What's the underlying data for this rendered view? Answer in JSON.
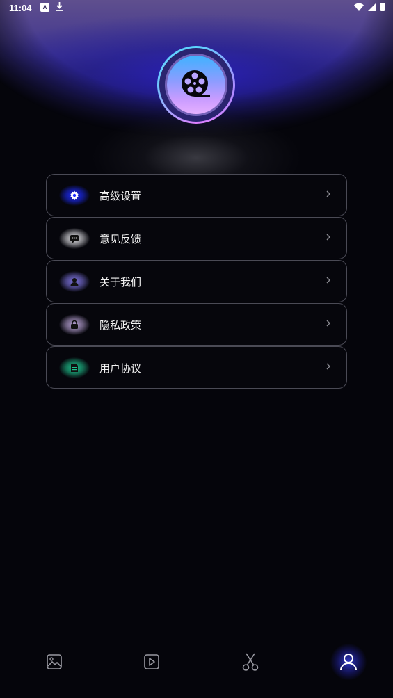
{
  "status_bar": {
    "time": "11:04",
    "a_icon": "A"
  },
  "logo": {
    "icon": "film-reel-icon"
  },
  "menu": {
    "items": [
      {
        "label": "高级设置",
        "icon": "gear-icon",
        "glow": "#1d2cff"
      },
      {
        "label": "意见反馈",
        "icon": "chat-bubble-icon",
        "glow": "#e8e8ec"
      },
      {
        "label": "关于我们",
        "icon": "person-icon",
        "glow": "#7e74e0"
      },
      {
        "label": "隐私政策",
        "icon": "lock-icon",
        "glow": "#b9a3d6"
      },
      {
        "label": "用户协议",
        "icon": "document-icon",
        "glow": "#1fc48e"
      }
    ]
  },
  "bottom_nav": {
    "items": [
      {
        "name": "image-icon",
        "active": false
      },
      {
        "name": "video-play-icon",
        "active": false
      },
      {
        "name": "scissors-icon",
        "active": false
      },
      {
        "name": "profile-icon",
        "active": true
      }
    ],
    "active_color": "#3f4bff"
  }
}
